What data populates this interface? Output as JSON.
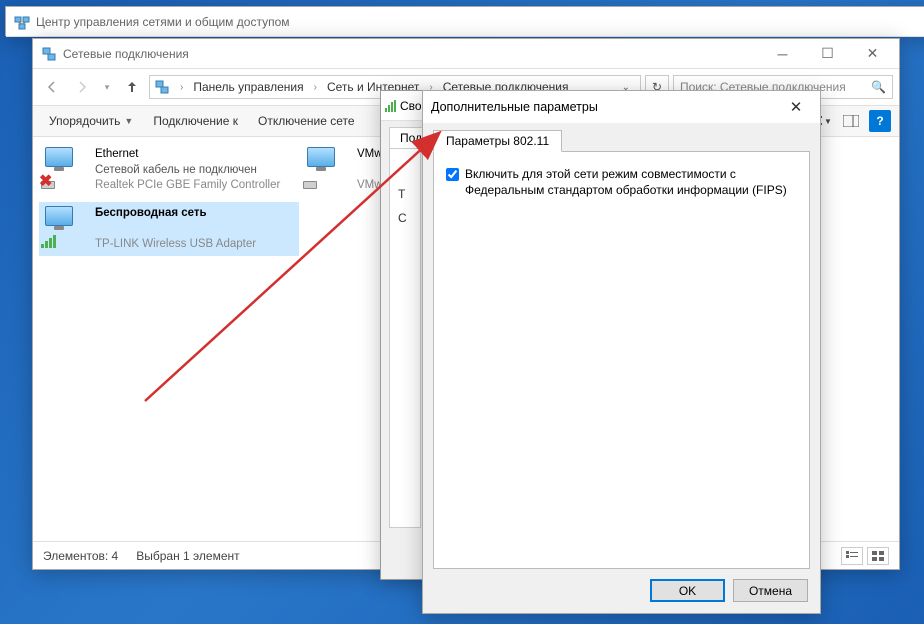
{
  "win1": {
    "title": "Центр управления сетями и общим доступом"
  },
  "win2": {
    "title": "Сетевые подключения",
    "breadcrumbs": {
      "b1": "Панель управления",
      "b2": "Сеть и Интернет",
      "b3": "Сетевые подключения"
    },
    "search_placeholder": "Поиск: Сетевые подключения",
    "toolbar": {
      "organize": "Упорядочить",
      "connect": "Подключение к",
      "disconnect": "Отключение сете"
    },
    "items": [
      {
        "name": "Ethernet",
        "status": "Сетевой кабель не подключен",
        "device": "Realtek PCIe GBE Family Controller"
      },
      {
        "name": "VMw",
        "status": "",
        "device": "VMw"
      },
      {
        "name": "Беспроводная сеть",
        "status": "",
        "device": "TP-LINK Wireless USB Adapter"
      }
    ],
    "status": {
      "count": "Элементов: 4",
      "selected": "Выбран 1 элемент"
    }
  },
  "win3": {
    "title": "Сво",
    "tab": "Под",
    "lines": [
      "Т",
      "С"
    ]
  },
  "win4": {
    "title": "Дополнительные параметры",
    "tab": "Параметры 802.11",
    "checkbox_label": "Включить для этой сети режим совместимости с Федеральным стандартом обработки информации (FIPS)",
    "ok": "OK",
    "cancel": "Отмена"
  }
}
